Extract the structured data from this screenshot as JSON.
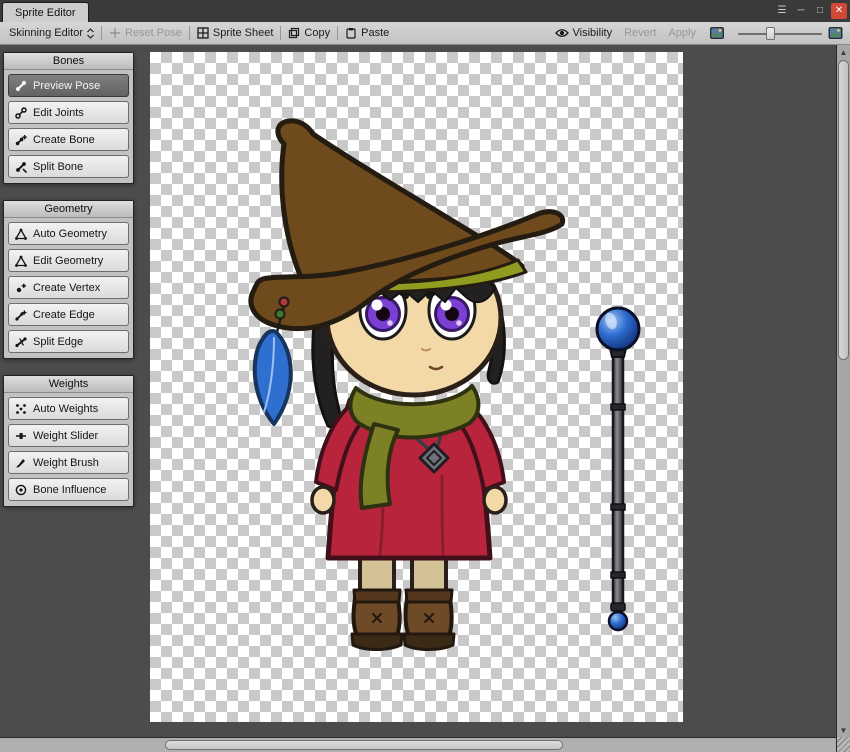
{
  "window": {
    "title": "Sprite Editor"
  },
  "toolbar": {
    "mode": "Skinning Editor",
    "reset_pose": "Reset Pose",
    "sprite_sheet": "Sprite Sheet",
    "copy": "Copy",
    "paste": "Paste",
    "visibility": "Visibility",
    "revert": "Revert",
    "apply": "Apply"
  },
  "panels": {
    "bones": {
      "title": "Bones",
      "buttons": [
        {
          "label": "Preview Pose",
          "active": true
        },
        {
          "label": "Edit Joints",
          "active": false
        },
        {
          "label": "Create Bone",
          "active": false
        },
        {
          "label": "Split Bone",
          "active": false
        }
      ]
    },
    "geometry": {
      "title": "Geometry",
      "buttons": [
        {
          "label": "Auto Geometry",
          "active": false
        },
        {
          "label": "Edit Geometry",
          "active": false
        },
        {
          "label": "Create Vertex",
          "active": false
        },
        {
          "label": "Create Edge",
          "active": false
        },
        {
          "label": "Split Edge",
          "active": false
        }
      ]
    },
    "weights": {
      "title": "Weights",
      "buttons": [
        {
          "label": "Auto Weights",
          "active": false
        },
        {
          "label": "Weight Slider",
          "active": false
        },
        {
          "label": "Weight Brush",
          "active": false
        },
        {
          "label": "Bone Influence",
          "active": false
        }
      ]
    }
  },
  "canvas": {
    "background": "#4c4c4c",
    "checker_light": "#ffffff",
    "checker_dark": "#c9c9c9"
  },
  "sprite": {
    "subject": "chibi witch character with staff",
    "colors": {
      "hat": "#6f4a1c",
      "hat_band": "#8f9c1f",
      "hair": "#232021",
      "skin": "#f3d9a7",
      "eye_iris": "#7b3fd4",
      "dress": "#b7243b",
      "scarf": "#7d8126",
      "socks": "#d2c295",
      "boots": "#6f4a26",
      "feather": "#2f6fd0",
      "orb": "#2e6bd0",
      "rod": "#5a5b60"
    }
  },
  "colors": {
    "titlebar": "#3a3a3a",
    "toolbar": "#c9c9c9",
    "close_button": "#d14836",
    "active_tool": "#6f6f6f"
  }
}
